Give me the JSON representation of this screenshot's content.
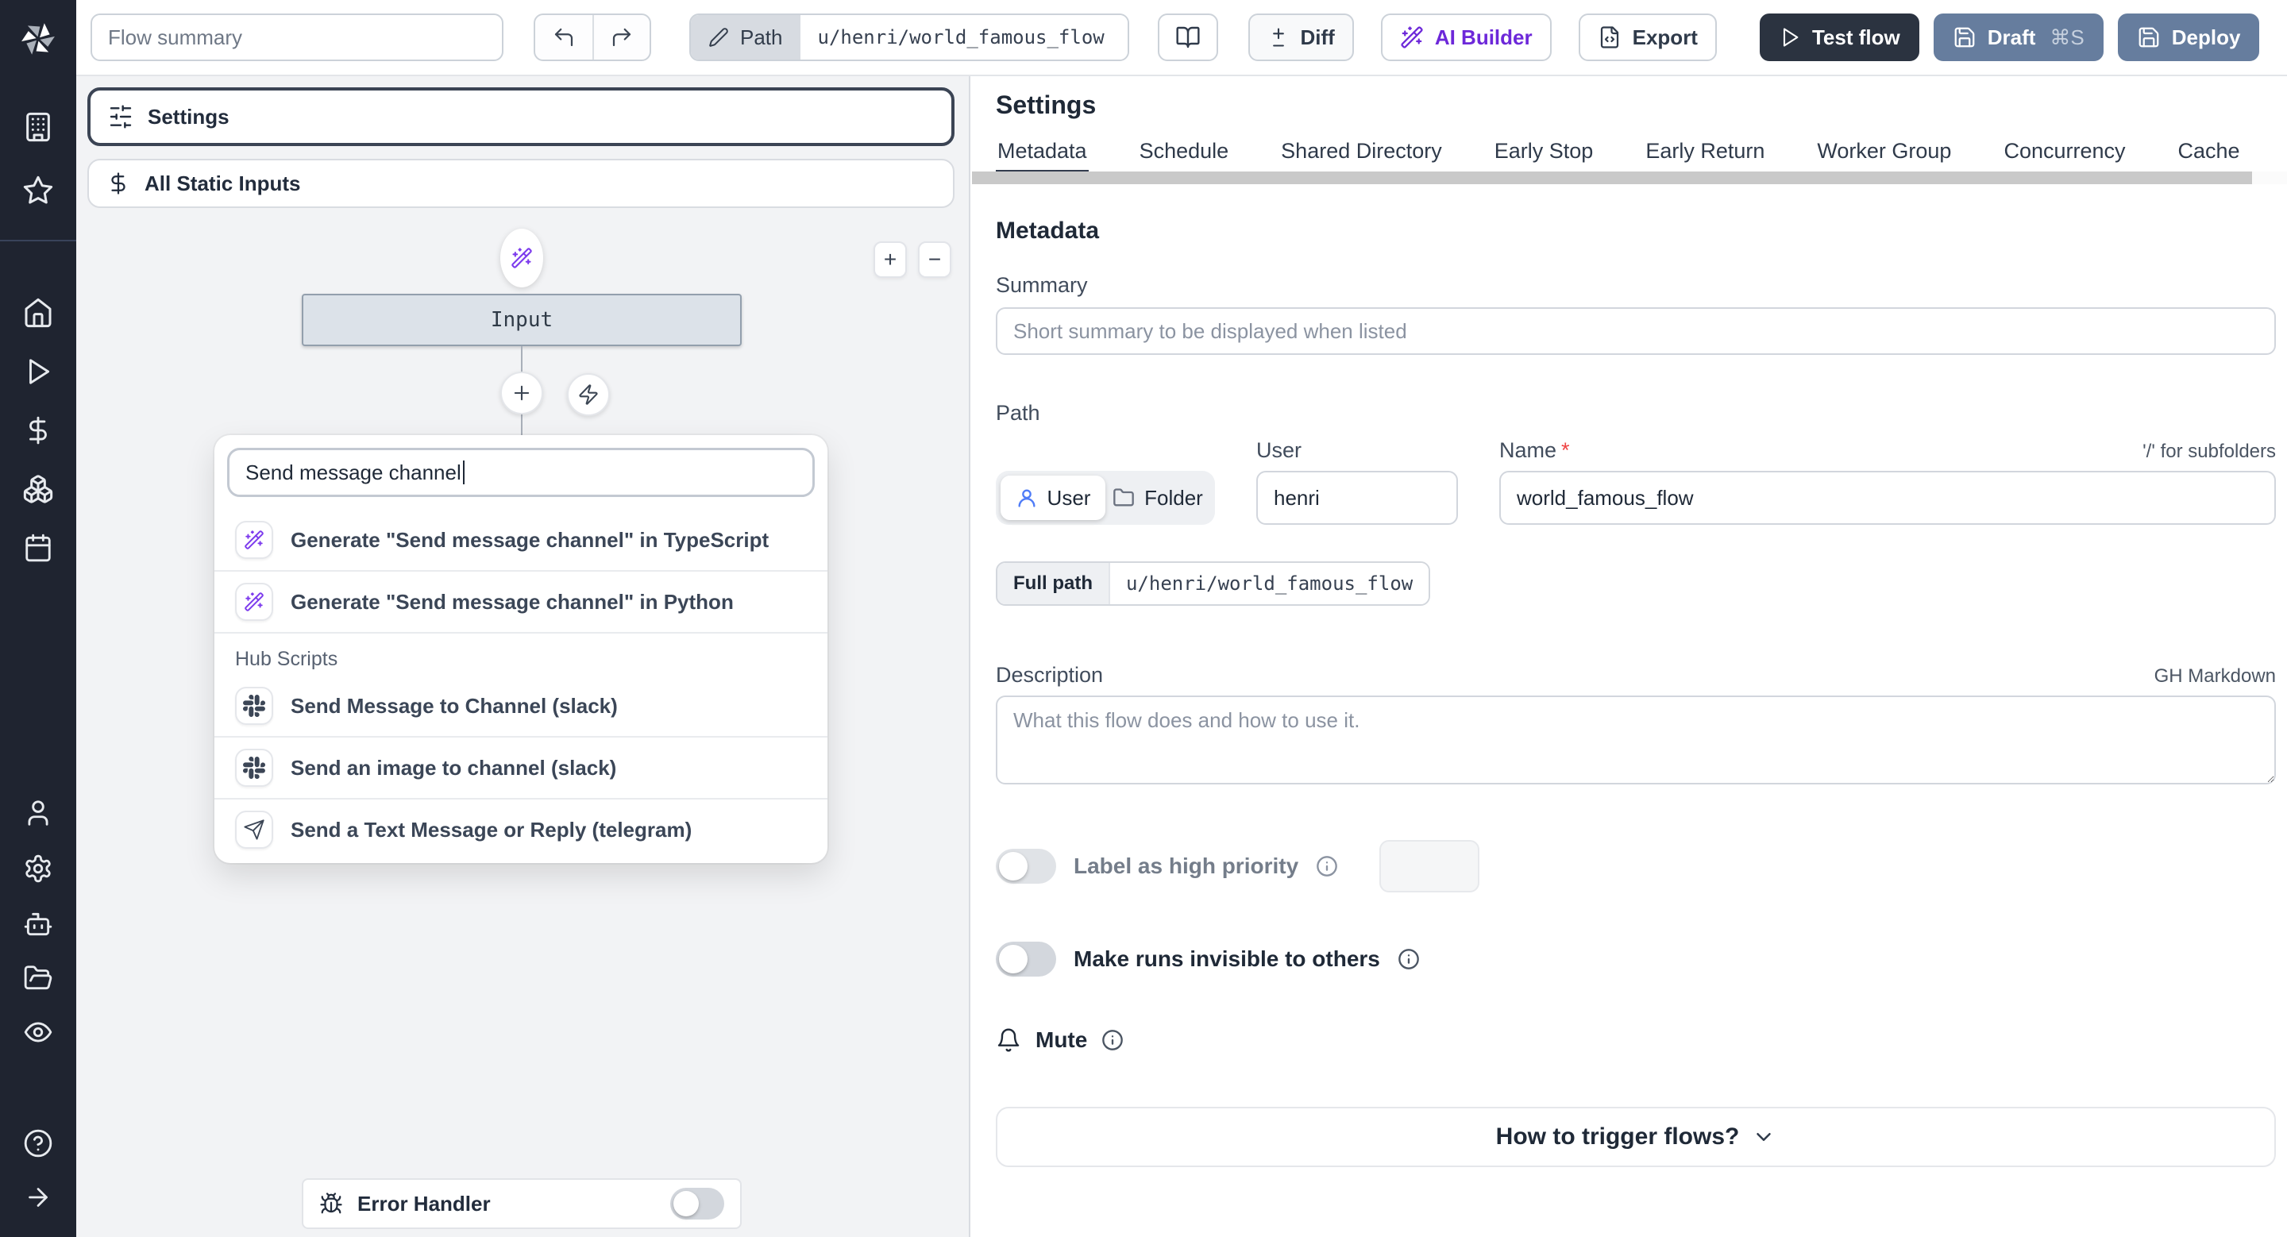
{
  "topbar": {
    "summary_placeholder": "Flow summary",
    "path_label": "Path",
    "path_value": "u/henri/world_famous_flow",
    "diff_label": "Diff",
    "ai_builder_label": "AI Builder",
    "export_label": "Export",
    "test_flow_label": "Test flow",
    "draft_label": "Draft",
    "draft_shortcut": "⌘S",
    "deploy_label": "Deploy"
  },
  "canvas": {
    "settings_label": "Settings",
    "static_inputs_label": "All Static Inputs",
    "input_node_label": "Input",
    "zoom_in_label": "+",
    "zoom_out_label": "−",
    "error_handler_label": "Error Handler",
    "search": {
      "value": "Send message channel",
      "generate_items": [
        {
          "icon": "wand-sparkles",
          "label": "Generate \"Send message channel\" in TypeScript"
        },
        {
          "icon": "wand-sparkles",
          "label": "Generate \"Send message channel\" in Python"
        }
      ],
      "hub_section_label": "Hub Scripts",
      "hub_items": [
        {
          "icon": "slack",
          "label": "Send Message to Channel (slack)"
        },
        {
          "icon": "slack",
          "label": "Send an image to channel (slack)"
        },
        {
          "icon": "telegram-send",
          "label": "Send a Text Message or Reply (telegram)"
        }
      ]
    }
  },
  "panel": {
    "title": "Settings",
    "tabs": [
      "Metadata",
      "Schedule",
      "Shared Directory",
      "Early Stop",
      "Early Return",
      "Worker Group",
      "Concurrency",
      "Cache"
    ],
    "active_tab": "Metadata",
    "metadata": {
      "heading": "Metadata",
      "summary_label": "Summary",
      "summary_placeholder": "Short summary to be displayed when listed",
      "path_label": "Path",
      "owner_kind_user": "User",
      "owner_kind_folder": "Folder",
      "user_label": "User",
      "user_value": "henri",
      "name_label": "Name",
      "name_required_mark": "*",
      "subfolder_hint": "'/' for subfolders",
      "name_value": "world_famous_flow",
      "full_path_label": "Full path",
      "full_path_value": "u/henri/world_famous_flow",
      "description_label": "Description",
      "markdown_hint": "GH Markdown",
      "description_placeholder": "What this flow does and how to use it.",
      "high_priority_label": "Label as high priority",
      "invisible_runs_label": "Make runs invisible to others",
      "mute_label": "Mute",
      "trigger_button_label": "How to trigger flows?"
    }
  },
  "colors": {
    "sidebar_bg": "#1f2430",
    "brand_purple": "#6d28d9",
    "primary_dark_button": "#2b3340",
    "deploy_slate_button": "#667d9e",
    "canvas_bg": "#f2f3f5",
    "active_tab_underline": "#333c4e",
    "required_red": "#ef4444"
  }
}
